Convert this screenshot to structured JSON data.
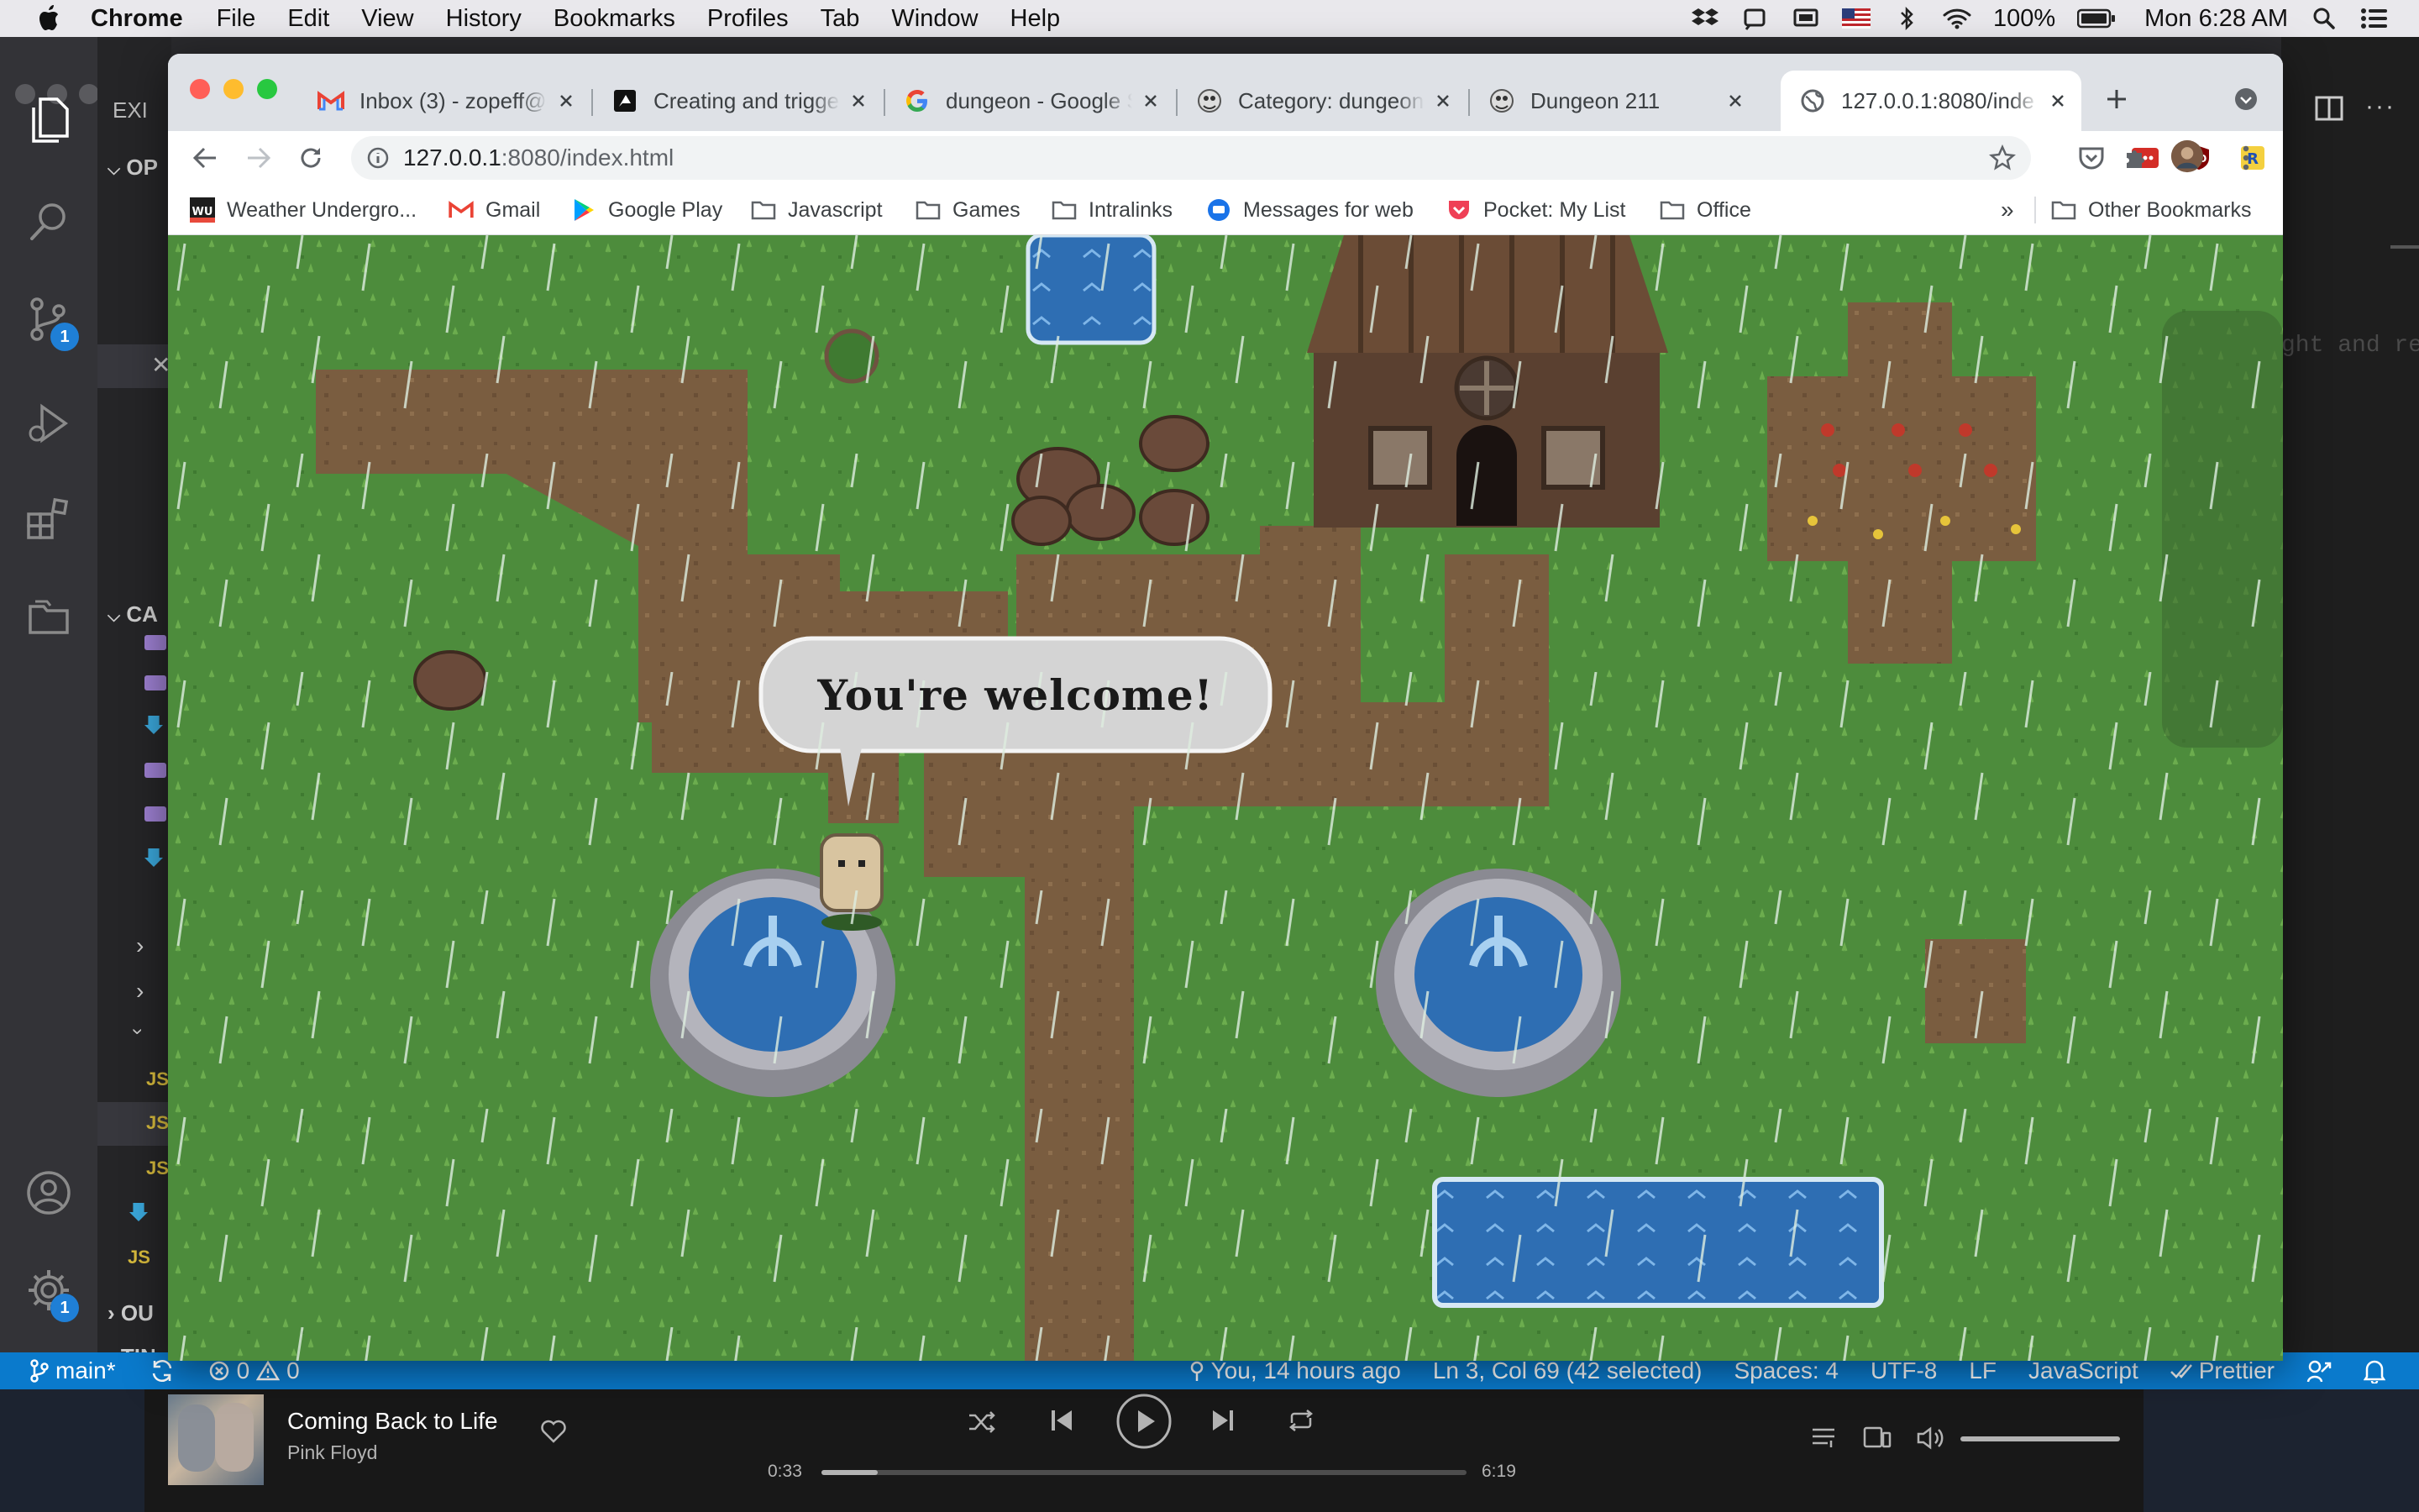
{
  "menubar": {
    "app": "Chrome",
    "items": [
      "File",
      "Edit",
      "View",
      "History",
      "Bookmarks",
      "Profiles",
      "Tab",
      "Window",
      "Help"
    ],
    "battery": "100%",
    "clock": "Mon 6:28 AM"
  },
  "vscode": {
    "sidebar": {
      "explorer_header": "EXI",
      "open_editors": "OP",
      "section_ca": "CA",
      "section_outline": "OU",
      "section_timeline": "TIN",
      "file_js": "JS"
    },
    "editor_fragment": "ght and re",
    "activity_badges": {
      "source_control": "1",
      "settings": "1"
    },
    "status": {
      "branch": "main*",
      "errors": "0",
      "warnings": "0",
      "blame": "You, 14 hours ago",
      "cursor": "Ln 3, Col 69 (42 selected)",
      "spaces": "Spaces: 4",
      "encoding": "UTF-8",
      "eol": "LF",
      "language": "JavaScript",
      "formatter": "Prettier"
    }
  },
  "chrome": {
    "tabs": [
      {
        "title": "Inbox (3) - zopeff@g",
        "icon": "gmail-icon"
      },
      {
        "title": "Creating and triggers",
        "icon": "phaser-icon"
      },
      {
        "title": "dungeon - Google Se",
        "icon": "google-icon"
      },
      {
        "title": "Category: dungeon",
        "icon": "wiki-icon"
      },
      {
        "title": "Dungeon 211",
        "icon": "wiki-icon"
      },
      {
        "title": "127.0.0.1:8080/inde",
        "icon": "globe-icon",
        "active": true
      }
    ],
    "url_host": "127.0.0.1",
    "url_path": ":8080/index.html",
    "bookmarks": [
      {
        "label": "Weather Undergro...",
        "icon": "wu-icon"
      },
      {
        "label": "Gmail",
        "icon": "gmail-icon"
      },
      {
        "label": "Google Play",
        "icon": "play-icon"
      },
      {
        "label": "Javascript",
        "icon": "folder-icon"
      },
      {
        "label": "Games",
        "icon": "folder-icon"
      },
      {
        "label": "Intralinks",
        "icon": "folder-icon"
      },
      {
        "label": "Messages for web",
        "icon": "messages-icon"
      },
      {
        "label": "Pocket: My List",
        "icon": "pocket-icon"
      },
      {
        "label": "Office",
        "icon": "folder-icon"
      }
    ],
    "bookmarks_overflow": "»",
    "other_bookmarks": "Other Bookmarks"
  },
  "game": {
    "speech": "You're welcome!"
  },
  "player": {
    "song": "Coming Back to Life",
    "artist": "Pink Floyd",
    "elapsed": "0:33",
    "duration": "6:19",
    "progress": 0.087,
    "volume": 1.0
  },
  "colors": {
    "grass": "#4a8a3a",
    "path": "#7a5c3e",
    "water": "#3a6fb0",
    "statusbar": "#0a7acc"
  }
}
